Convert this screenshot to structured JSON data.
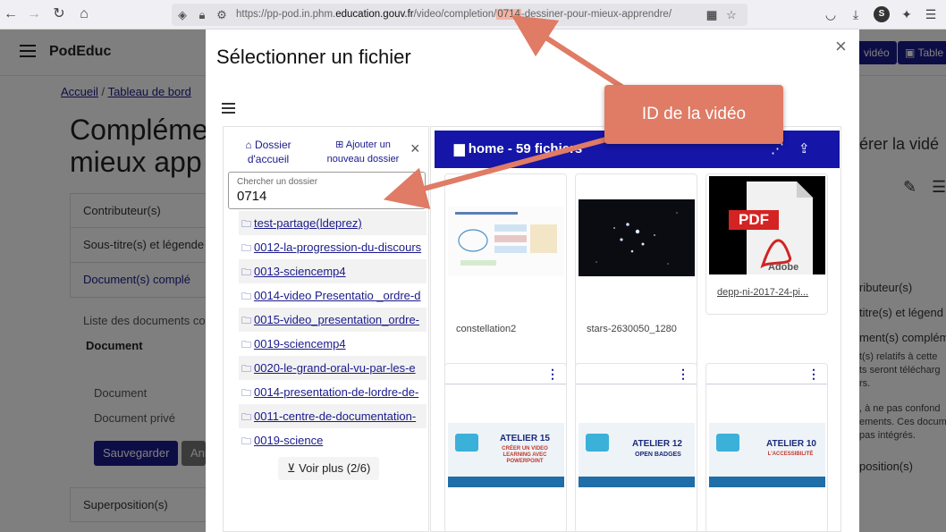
{
  "browser": {
    "url_prefix": "https://pp-pod.in.phm.",
    "url_domain": "education.gouv.fr",
    "url_path_a": "/video/completion/",
    "url_highlight": "0714",
    "url_path_b": "-dessiner-pour-mieux-apprendre/"
  },
  "app": {
    "brand": "PodEduc",
    "header_btn_video": "vidéo",
    "header_btn_table": "Table",
    "breadcrumb_home": "Accueil",
    "breadcrumb_sep": "/",
    "breadcrumb_dashboard": "Tableau de bord",
    "page_title_line1": "Compléme",
    "page_title_line2": "mieux app",
    "accordion": [
      "Contributeur(s)",
      "Sous-titre(s) et légende",
      "Document(s) complé",
      "Superposition(s)"
    ],
    "doc_list_text": "Liste des documents co",
    "doc_heading": "Document",
    "doc_label": "Document",
    "doc_private_label": "Document privé",
    "save_button": "Sauvegarder",
    "cancel_button": "Ann",
    "right_heading": "érer la vidé",
    "right_items": [
      "ributeur(s)",
      "titre(s) et légend",
      "ment(s) complém",
      "position(s)"
    ],
    "right_lines": [
      "t(s) relatifs à cette",
      "ts seront télécharg",
      "rs.",
      ", à ne pas confond",
      "ements. Ces docum",
      "pas intégrés."
    ]
  },
  "modal": {
    "title": "Sélectionner un fichier",
    "home_folder_label": "Dossier d'accueil",
    "add_folder_label": "Ajouter un nouveau dossier",
    "search_label": "Chercher un dossier",
    "search_value": "0714",
    "folders": [
      "test-partage(ldeprez)",
      "0012-la-progression-du-discours",
      "0013-sciencemp4",
      "0014-video Presentatio _ordre-d",
      "0015-video_presentation_ordre-",
      "0019-sciencemp4",
      "0020-le-grand-oral-vu-par-les-e",
      "0014-presentation-de-lordre-de-",
      "0011-centre-de-documentation-",
      "0019-science"
    ],
    "load_more": "Voir plus (2/6)",
    "files_header": "home - 59 fichiers",
    "files": [
      {
        "name": "constellation2"
      },
      {
        "name": "stars-2630050_1280"
      },
      {
        "name": "depp-ni-2017-24-pi..."
      },
      {
        "name": "ATELIER 15",
        "sub": "CRÉER UN VIDEO LEARNING AVEC POWERPOINT"
      },
      {
        "name": "ATELIER 12",
        "sub": "OPEN BADGES"
      },
      {
        "name": "ATELIER 10",
        "sub": "L'ACCESSIBILITÉ"
      }
    ],
    "pdf_label": "PDF",
    "adobe_label": "Adobe"
  },
  "annotation": {
    "callout_text": "ID de la vidéo"
  },
  "colors": {
    "brand_blue": "#1a1a8c",
    "header_blue": "#1515a8",
    "callout": "#e07b65"
  }
}
